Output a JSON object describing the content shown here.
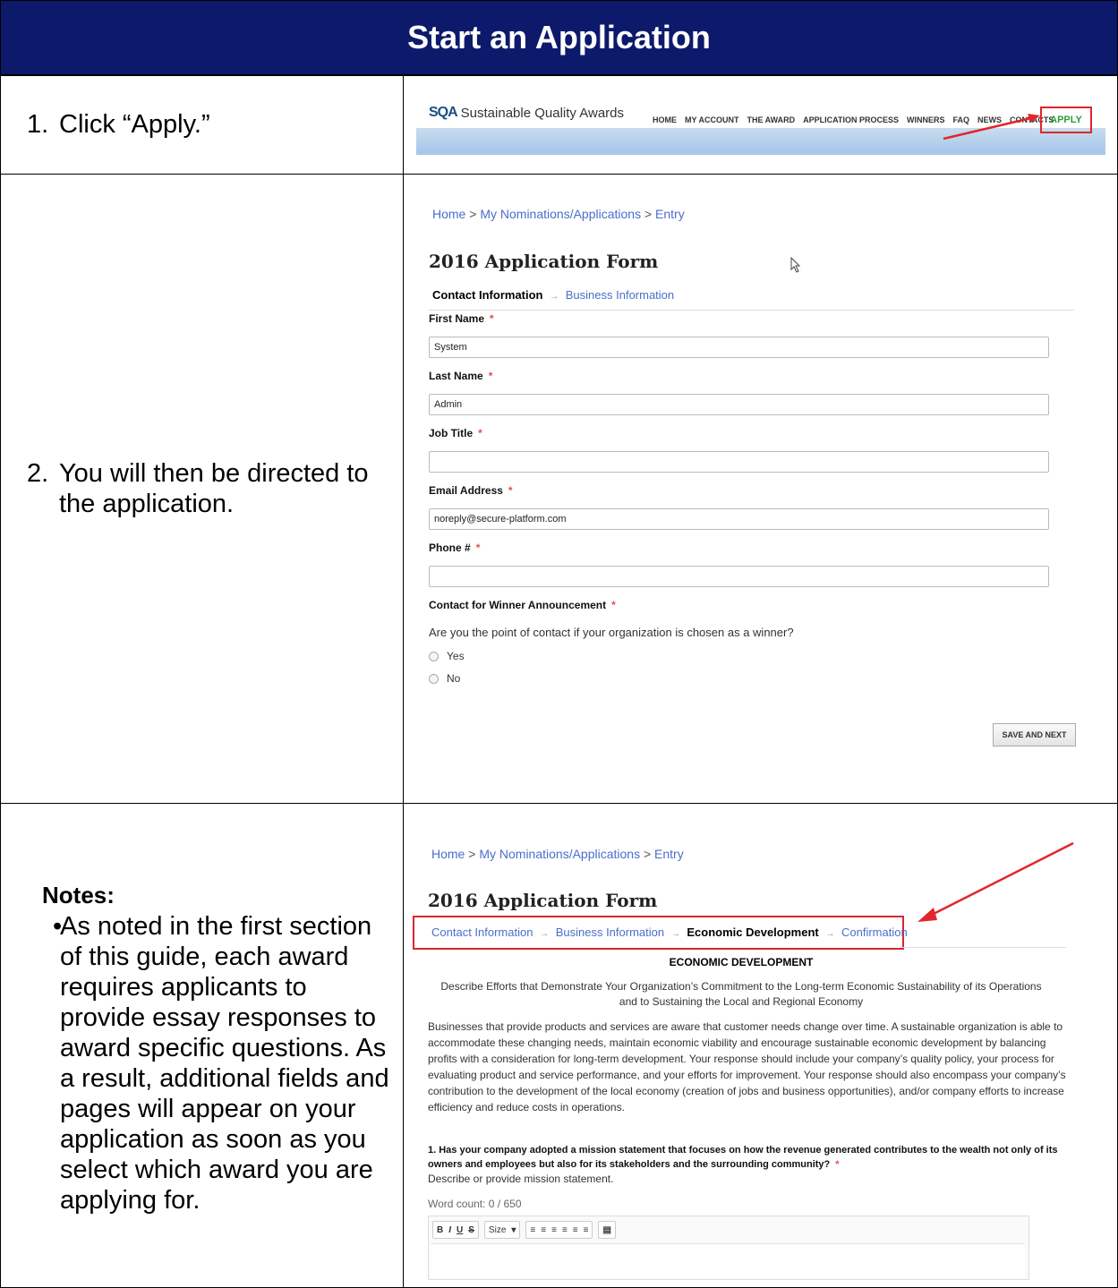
{
  "title": "Start an Application",
  "rows": [
    {
      "step_number": "1.",
      "step_text": "Click “Apply.”"
    },
    {
      "step_number": "2.",
      "step_text": "You will then be directed to the application."
    }
  ],
  "notes": {
    "heading": "Notes:",
    "items": [
      "As noted in the first section of this guide, each award requires applicants to provide essay responses to award specific questions. As a result, additional fields and pages will appear on your application as soon as you select which award you are applying for."
    ]
  },
  "screenshot1": {
    "logo_mark": "SQA",
    "logo_text": "Sustainable Quality Awards",
    "nav": [
      "HOME",
      "MY ACCOUNT",
      "THE AWARD",
      "APPLICATION PROCESS",
      "WINNERS",
      "FAQ",
      "NEWS",
      "CONTACTS"
    ],
    "apply": "APPLY",
    "highlight_color": "#e1262b"
  },
  "screenshot2": {
    "breadcrumb": [
      "Home",
      "My Nominations/Applications",
      "Entry"
    ],
    "form_title": "2016 Application Form",
    "tabs": [
      "Contact Information",
      "Business Information"
    ],
    "fields": [
      {
        "label": "First Name",
        "value": "System"
      },
      {
        "label": "Last Name",
        "value": "Admin"
      },
      {
        "label": "Job Title",
        "value": ""
      },
      {
        "label": "Email Address",
        "value": "noreply@secure-platform.com"
      },
      {
        "label": "Phone #",
        "value": ""
      }
    ],
    "winner_label": "Contact for Winner Announcement",
    "winner_question": "Are you the point of contact if your organization is chosen as a winner?",
    "options": [
      "Yes",
      "No"
    ],
    "save_button": "SAVE AND NEXT"
  },
  "screenshot3": {
    "breadcrumb": [
      "Home",
      "My Nominations/Applications",
      "Entry"
    ],
    "form_title": "2016 Application Form",
    "tabs": [
      "Contact Information",
      "Business Information",
      "Economic Development",
      "Confirmation"
    ],
    "section_heading": "ECONOMIC DEVELOPMENT",
    "subheading": "Describe Efforts that Demonstrate Your Organization’s Commitment to the Long-term Economic Sustainability of its Operations and to Sustaining the Local and Regional Economy",
    "body": "Businesses that provide products and services are aware that customer needs change over time.  A sustainable organization is able to accommodate these changing needs, maintain economic viability and encourage sustainable economic development by balancing profits with a consideration for long-term development.  Your response should include your company’s quality policy, your process for evaluating product and service performance, and your efforts for improvement.  Your response should also encompass your company’s contribution to the development of the local economy (creation of jobs and business opportunities), and/or company efforts to increase efficiency and reduce costs in operations.",
    "question": "1. Has your company adopted a mission statement that focuses on how the revenue generated contributes to the wealth not only of its owners and employees but also for its stakeholders and the surrounding community?",
    "question_desc": "Describe or provide mission statement.",
    "word_count": "Word count: 0 / 650",
    "toolbar": {
      "bold": "B",
      "italic": "I",
      "underline": "U",
      "strike": "S",
      "size": "Size"
    }
  }
}
